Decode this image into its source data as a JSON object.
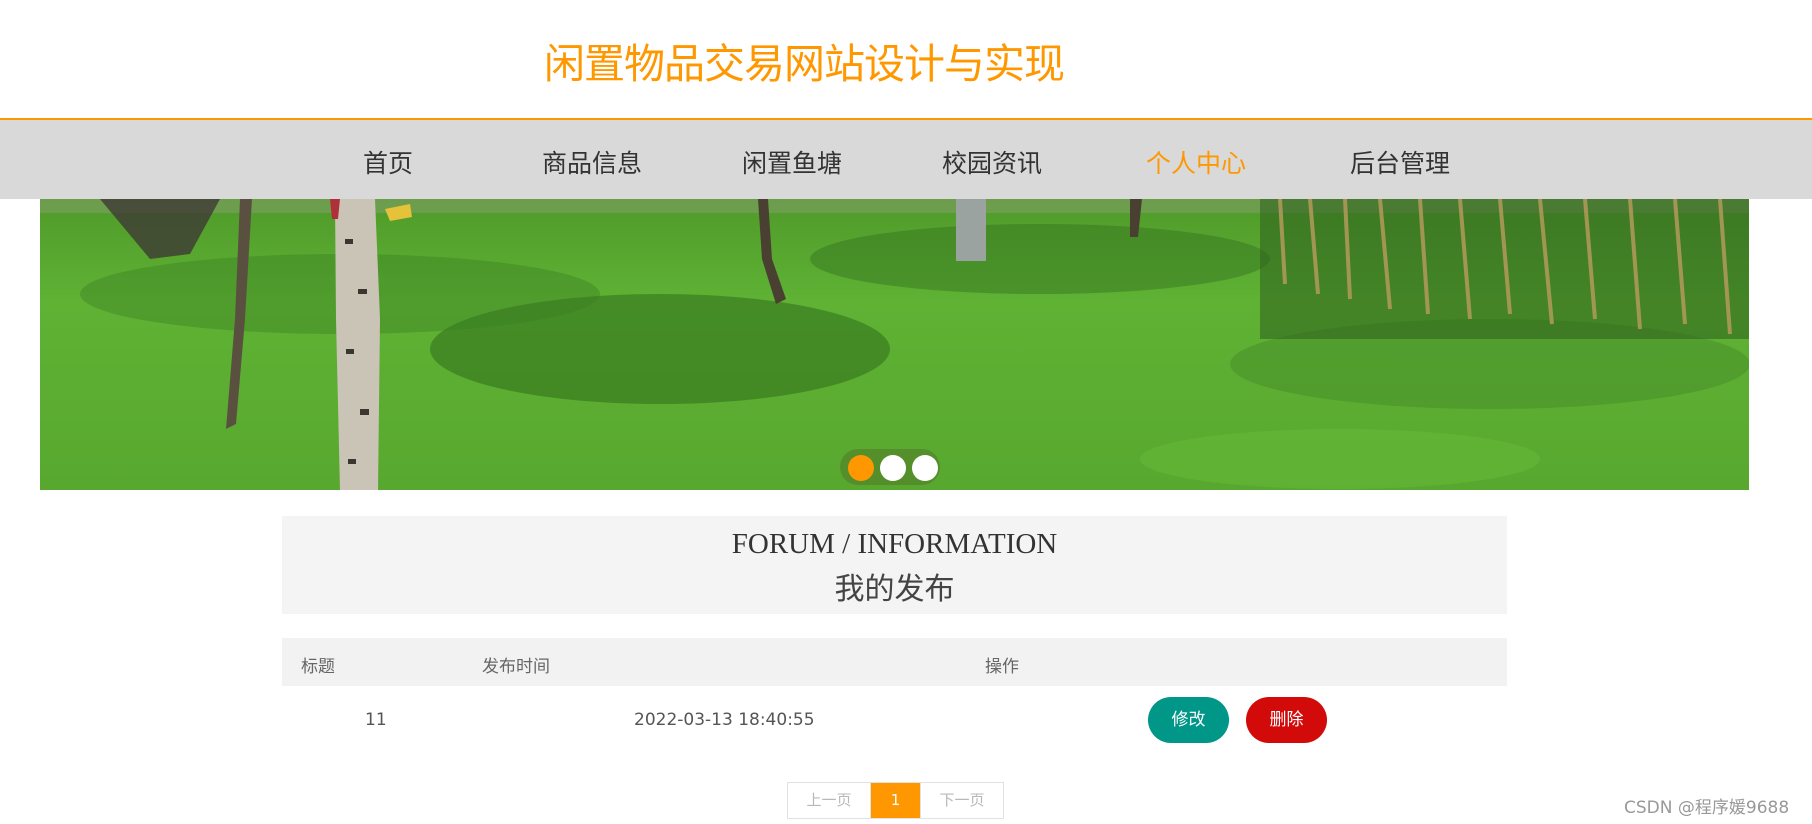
{
  "header": {
    "site_title": "闲置物品交易网站设计与实现"
  },
  "nav": {
    "items": [
      {
        "label": "首页"
      },
      {
        "label": "商品信息"
      },
      {
        "label": "闲置鱼塘"
      },
      {
        "label": "校园资讯"
      },
      {
        "label": "个人中心",
        "active": true
      },
      {
        "label": "后台管理"
      }
    ],
    "active_color": "#ff9800"
  },
  "banner": {
    "slides": 3,
    "active_slide": 1
  },
  "section": {
    "title_en": "FORUM / INFORMATION",
    "title_cn": "我的发布"
  },
  "table": {
    "headers": [
      "标题",
      "发布时间",
      "操作"
    ],
    "rows": [
      {
        "title": "11",
        "time": "2022-03-13 18:40:55",
        "edit_label": "修改",
        "delete_label": "删除"
      }
    ]
  },
  "pagination": {
    "prev": "上一页",
    "current": "1",
    "next": "下一页"
  },
  "watermark": "CSDN @程序媛9688",
  "colors": {
    "accent": "#ff9800",
    "edit": "#009688",
    "delete": "#d20a0a"
  }
}
